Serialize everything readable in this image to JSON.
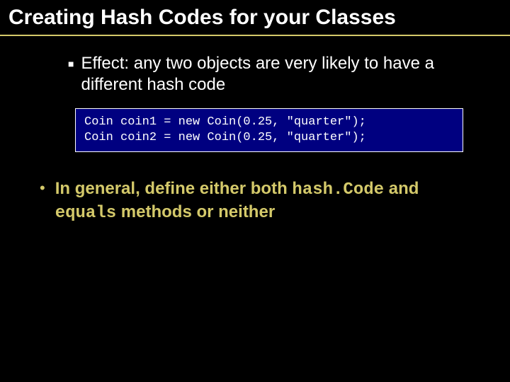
{
  "title": "Creating Hash Codes for your Classes",
  "bullet1": "Effect: any two objects are very likely to have a different hash code",
  "code": "Coin coin1 = new Coin(0.25, \"quarter\");\nCoin coin2 = new Coin(0.25, \"quarter\");",
  "bullet2_part1": "In general, define either both ",
  "bullet2_code1": "hash.Code",
  "bullet2_part2": " and ",
  "bullet2_code2": "equals",
  "bullet2_part3": " methods or neither"
}
